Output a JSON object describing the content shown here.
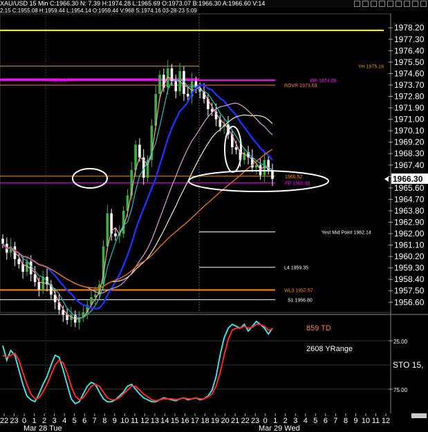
{
  "window": {
    "title": "XAU/USD 15 Min  C:1966.30  N: 7.39  H:1974.28  L:1965.69  O:1973.07  B:1966.30  A:1966.60  V:14",
    "subtitle": "2:15  C:1955.08  H:1959.44  L:1954.14  O:1959.44  V:968  S:1974.16  03-28-23  5:09",
    "toolbar_icons": [
      "toolbar-icon-1",
      "toolbar-icon-2",
      "toolbar-icon-3",
      "toolbar-icon-4",
      "toolbar-icon-5",
      "toolbar-icon-6",
      "toolbar-icon-7",
      "toolbar-icon-8",
      "toolbar-icon-9"
    ]
  },
  "chart_data": [
    {
      "type": "candlestick",
      "instrument": "XAU/USD",
      "timeframe": "15 Min",
      "price_axis": {
        "ticks": [
          "1978.20",
          "1977.30",
          "1976.40",
          "1975.50",
          "1974.60",
          "1973.70",
          "1972.80",
          "1971.90",
          "1971.00",
          "1970.10",
          "1969.20",
          "1968.30",
          "1967.40",
          "1966.50",
          "1965.60",
          "1964.70",
          "1963.80",
          "1962.90",
          "1962.00",
          "1961.10",
          "1960.20",
          "1959.30",
          "1958.40",
          "1957.50",
          "1956.60"
        ],
        "ylim": [
          1955.8,
          1979.3
        ],
        "last_price": "1966.30"
      },
      "time_axis": {
        "hour_ticks": [
          "22",
          "23",
          "0",
          "1",
          "2",
          "3",
          "4",
          "5",
          "6",
          "7",
          "8",
          "9",
          "10",
          "11",
          "12",
          "13",
          "14",
          "15",
          "16",
          "17",
          "18",
          "19",
          "20",
          "21",
          "22",
          "23",
          "0",
          "1",
          "2",
          "3",
          "4",
          "5",
          "6",
          "7",
          "8",
          "9",
          "10",
          "11",
          "12"
        ],
        "date_labels": [
          "Mar 28 Tue",
          "Mar 29 Wed"
        ]
      },
      "candles_close": [
        1961.2,
        1960.5,
        1961.0,
        1960.0,
        1959.6,
        1959.0,
        1959.8,
        1958.8,
        1958.2,
        1957.6,
        1958.6,
        1958.0,
        1957.2,
        1956.6,
        1956.0,
        1955.6,
        1955.2,
        1955.6,
        1955.0,
        1955.4,
        1955.8,
        1956.4,
        1957.0,
        1957.2,
        1958.0,
        1961.0,
        1963.6,
        1962.0,
        1961.8,
        1962.0,
        1963.8,
        1965.0,
        1967.0,
        1969.0,
        1968.0,
        1966.4,
        1967.8,
        1970.5,
        1973.0,
        1974.5,
        1973.5,
        1975.0,
        1974.0,
        1973.2,
        1974.8,
        1973.0,
        1972.8,
        1974.0,
        1973.4,
        1973.2,
        1972.6,
        1971.8,
        1971.6,
        1971.0,
        1970.4,
        1970.6,
        1969.8,
        1968.8,
        1968.6,
        1967.8,
        1968.4,
        1968.0,
        1967.2,
        1967.4,
        1966.6,
        1967.8,
        1967.0,
        1966.3
      ],
      "levels": [
        {
          "label": "",
          "value": 1978.0,
          "color": "#ffff00"
        },
        {
          "label": "YH 1975.18",
          "value": 1975.18,
          "color": "#d8a000"
        },
        {
          "label": "WP 1974.08",
          "value": 1974.08,
          "color": "#ff00ff"
        },
        {
          "label": "1974.16",
          "value": 1974.16,
          "color": "#ff00ff"
        },
        {
          "label": "ROVR 1973.69",
          "value": 1973.69,
          "color": "#ff7f30"
        },
        {
          "label": "1966.52",
          "value": 1966.52,
          "color": "#ff8c00"
        },
        {
          "label": "PP 1965.99",
          "value": 1965.99,
          "color": "#ff00ff"
        },
        {
          "label": "Yest Mid Point 1962.14",
          "value": 1962.14,
          "color": "#ffffff"
        },
        {
          "label": "L4 1959.35",
          "value": 1959.35,
          "color": "#ffffff"
        },
        {
          "label": "WL3 1957.57",
          "value": 1957.57,
          "color": "#ff8c00"
        },
        {
          "label": "S1 1956.80",
          "value": 1956.8,
          "color": "#ffffff"
        }
      ]
    },
    {
      "type": "line",
      "name": "stochastic",
      "label": "STO 15,",
      "ticks": [
        "25.00",
        "75.00"
      ],
      "ylim": [
        0,
        100
      ],
      "annotations": [
        "859 TD",
        "2608 YRange"
      ],
      "series": [
        {
          "color": "#40e0e0",
          "values": [
            30,
            45,
            35,
            40,
            55,
            70,
            82,
            86,
            88,
            80,
            70,
            62,
            50,
            40,
            42,
            55,
            70,
            85,
            90,
            88,
            80,
            72,
            68,
            70,
            78,
            85,
            88,
            88,
            86,
            82,
            78,
            72,
            70,
            75,
            80,
            84,
            86,
            88,
            88,
            86,
            84,
            85,
            86,
            87,
            85,
            84,
            86,
            85,
            84,
            86,
            85,
            82,
            76,
            62,
            40,
            22,
            12,
            8,
            10,
            12,
            8,
            15,
            10,
            5,
            8,
            12,
            18,
            12
          ]
        },
        {
          "color": "#ff2a2a",
          "values": [
            40,
            42,
            40,
            38,
            45,
            58,
            70,
            80,
            85,
            84,
            78,
            70,
            60,
            50,
            45,
            48,
            58,
            72,
            82,
            86,
            84,
            78,
            72,
            70,
            72,
            78,
            84,
            86,
            86,
            84,
            80,
            76,
            72,
            72,
            76,
            80,
            83,
            86,
            87,
            86,
            85,
            85,
            85,
            86,
            85,
            84,
            85,
            85,
            84,
            85,
            85,
            83,
            80,
            72,
            58,
            40,
            24,
            14,
            12,
            12,
            10,
            12,
            11,
            8,
            8,
            10,
            14,
            13
          ]
        }
      ]
    }
  ]
}
